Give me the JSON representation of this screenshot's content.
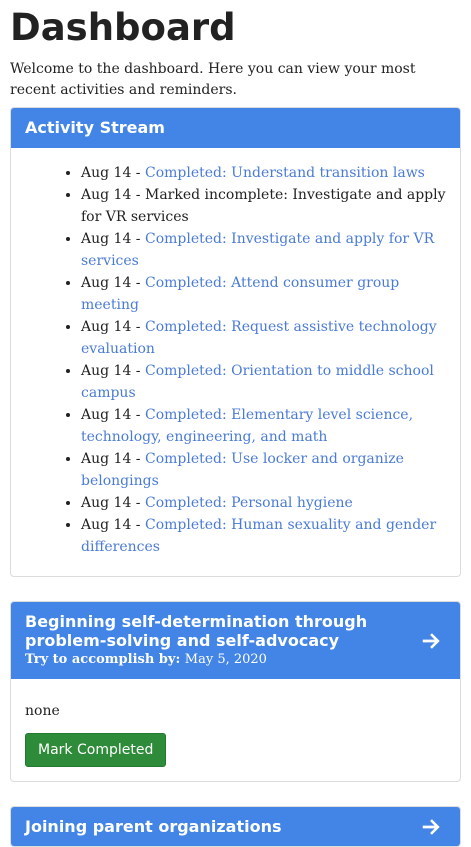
{
  "page": {
    "title": "Dashboard",
    "intro": "Welcome to the dashboard. Here you can view your most recent activities and reminders."
  },
  "activity": {
    "heading": "Activity Stream",
    "items": [
      {
        "date": "Aug 14",
        "text": "Completed: Understand transition laws",
        "link": true
      },
      {
        "date": "Aug 14",
        "text": "Marked incomplete: Investigate and apply for VR services",
        "link": false
      },
      {
        "date": "Aug 14",
        "text": "Completed: Investigate and apply for VR services",
        "link": true
      },
      {
        "date": "Aug 14",
        "text": "Completed: Attend consumer group meeting",
        "link": true
      },
      {
        "date": "Aug 14",
        "text": "Completed: Request assistive technology evaluation",
        "link": true
      },
      {
        "date": "Aug 14",
        "text": "Completed: Orientation to middle school campus",
        "link": true
      },
      {
        "date": "Aug 14",
        "text": "Completed: Elementary level science, technology, engineering, and math",
        "link": true
      },
      {
        "date": "Aug 14",
        "text": "Completed: Use locker and organize belongings",
        "link": true
      },
      {
        "date": "Aug 14",
        "text": "Completed: Personal hygiene",
        "link": true
      },
      {
        "date": "Aug 14",
        "text": "Completed: Human sexuality and gender differences",
        "link": true
      }
    ]
  },
  "tasks": [
    {
      "title": "Beginning self-determination through problem-solving and self-advocacy",
      "accomplish_label": "Try to accomplish by:",
      "accomplish_date": "May 5, 2020",
      "body_text": "none",
      "button_label": "Mark Completed",
      "icon": "arrow-right-icon"
    },
    {
      "title": "Joining parent organizations",
      "icon": "arrow-right-icon"
    }
  ],
  "colors": {
    "heading_bg": "#4285e6",
    "link": "#4a7bd6",
    "button_bg": "#2e8b3a"
  }
}
